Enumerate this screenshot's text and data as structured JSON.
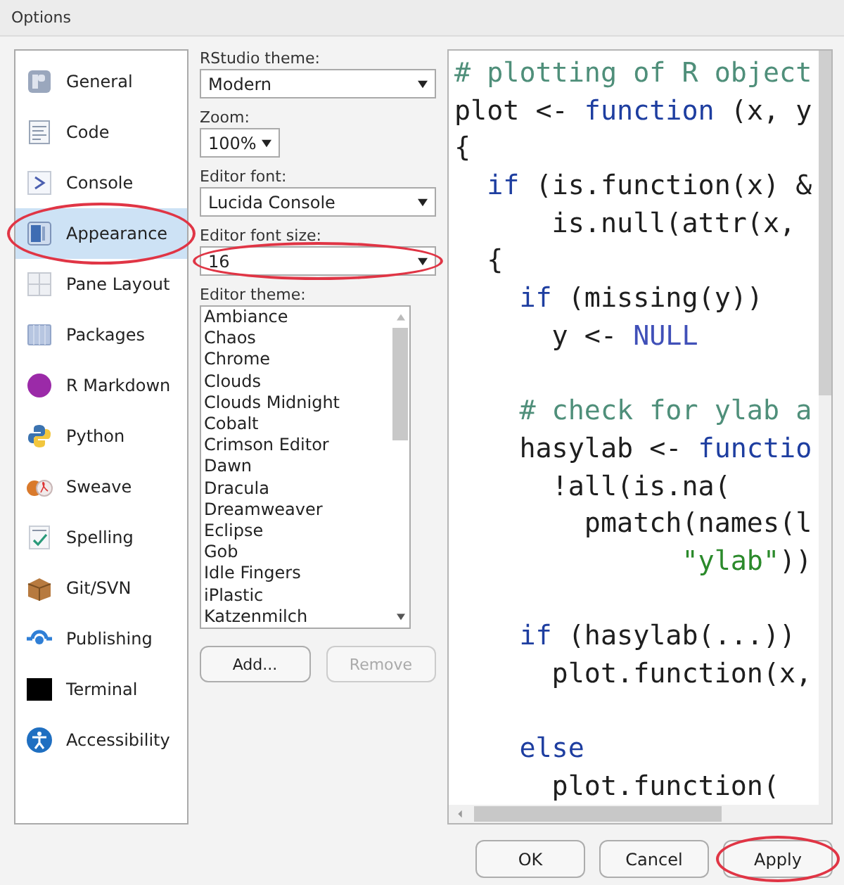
{
  "window": {
    "title": "Options"
  },
  "sidebar": {
    "items": [
      {
        "label": "General",
        "selected": false,
        "circled": false
      },
      {
        "label": "Code",
        "selected": false,
        "circled": false
      },
      {
        "label": "Console",
        "selected": false,
        "circled": false
      },
      {
        "label": "Appearance",
        "selected": true,
        "circled": true
      },
      {
        "label": "Pane Layout",
        "selected": false,
        "circled": false
      },
      {
        "label": "Packages",
        "selected": false,
        "circled": false
      },
      {
        "label": "R Markdown",
        "selected": false,
        "circled": false
      },
      {
        "label": "Python",
        "selected": false,
        "circled": false
      },
      {
        "label": "Sweave",
        "selected": false,
        "circled": false
      },
      {
        "label": "Spelling",
        "selected": false,
        "circled": false
      },
      {
        "label": "Git/SVN",
        "selected": false,
        "circled": false
      },
      {
        "label": "Publishing",
        "selected": false,
        "circled": false
      },
      {
        "label": "Terminal",
        "selected": false,
        "circled": false
      },
      {
        "label": "Accessibility",
        "selected": false,
        "circled": false
      }
    ]
  },
  "settings": [
    {
      "label": "RStudio theme:",
      "value": "Modern",
      "kind": "wide",
      "circled": false
    },
    {
      "label": "Zoom:",
      "value": "100%",
      "kind": "narrow",
      "circled": false
    },
    {
      "label": "Editor font:",
      "value": "Lucida Console",
      "kind": "wide",
      "circled": false
    },
    {
      "label": "Editor font size:",
      "value": "16",
      "kind": "wide",
      "circled": true
    }
  ],
  "editor_theme": {
    "label": "Editor theme:",
    "items": [
      "Ambiance",
      "Chaos",
      "Chrome",
      "Clouds",
      "Clouds Midnight",
      "Cobalt",
      "Crimson Editor",
      "Dawn",
      "Dracula",
      "Dreamweaver",
      "Eclipse",
      "Gob",
      "Idle Fingers",
      "iPlastic",
      "Katzenmilch"
    ],
    "buttons": [
      {
        "label": "Add...",
        "disabled": false
      },
      {
        "label": "Remove",
        "disabled": true
      }
    ]
  },
  "preview": {
    "lines": [
      {
        "tokens": [
          {
            "kind": "comment",
            "text": "# plotting of R object"
          }
        ]
      },
      {
        "tokens": [
          {
            "kind": "plain",
            "text": "plot <- "
          },
          {
            "kind": "keyword",
            "text": "function"
          },
          {
            "kind": "plain",
            "text": " (x, y"
          }
        ]
      },
      {
        "tokens": [
          {
            "kind": "plain",
            "text": "{"
          }
        ]
      },
      {
        "tokens": [
          {
            "kind": "keyword",
            "text": "  if"
          },
          {
            "kind": "plain",
            "text": " (is.function(x) &"
          }
        ]
      },
      {
        "tokens": [
          {
            "kind": "plain",
            "text": "      is.null(attr(x,"
          }
        ]
      },
      {
        "tokens": [
          {
            "kind": "plain",
            "text": "  {"
          }
        ]
      },
      {
        "tokens": [
          {
            "kind": "keyword",
            "text": "    if"
          },
          {
            "kind": "plain",
            "text": " (missing(y))"
          }
        ]
      },
      {
        "tokens": [
          {
            "kind": "plain",
            "text": "      y <- "
          },
          {
            "kind": "constant",
            "text": "NULL"
          }
        ]
      },
      {
        "kind": "blank"
      },
      {
        "tokens": [
          {
            "kind": "comment",
            "text": "    # check for ylab a"
          }
        ]
      },
      {
        "tokens": [
          {
            "kind": "plain",
            "text": "    hasylab <- "
          },
          {
            "kind": "keyword",
            "text": "functio"
          }
        ]
      },
      {
        "tokens": [
          {
            "kind": "plain",
            "text": "      !all(is.na("
          }
        ]
      },
      {
        "tokens": [
          {
            "kind": "plain",
            "text": "        pmatch(names(l"
          }
        ]
      },
      {
        "tokens": [
          {
            "kind": "string",
            "text": "              \"ylab\""
          },
          {
            "kind": "plain",
            "text": "))"
          }
        ]
      },
      {
        "kind": "blank"
      },
      {
        "tokens": [
          {
            "kind": "keyword",
            "text": "    if"
          },
          {
            "kind": "plain",
            "text": " (hasylab(...))"
          }
        ]
      },
      {
        "tokens": [
          {
            "kind": "plain",
            "text": "      plot.function(x,"
          }
        ]
      },
      {
        "kind": "blank"
      },
      {
        "tokens": [
          {
            "kind": "keyword",
            "text": "    else"
          }
        ]
      },
      {
        "tokens": [
          {
            "kind": "plain",
            "text": "      plot.function("
          }
        ]
      }
    ]
  },
  "buttons": [
    {
      "label": "OK",
      "circled": false
    },
    {
      "label": "Cancel",
      "circled": false
    },
    {
      "label": "Apply",
      "circled": true
    }
  ]
}
